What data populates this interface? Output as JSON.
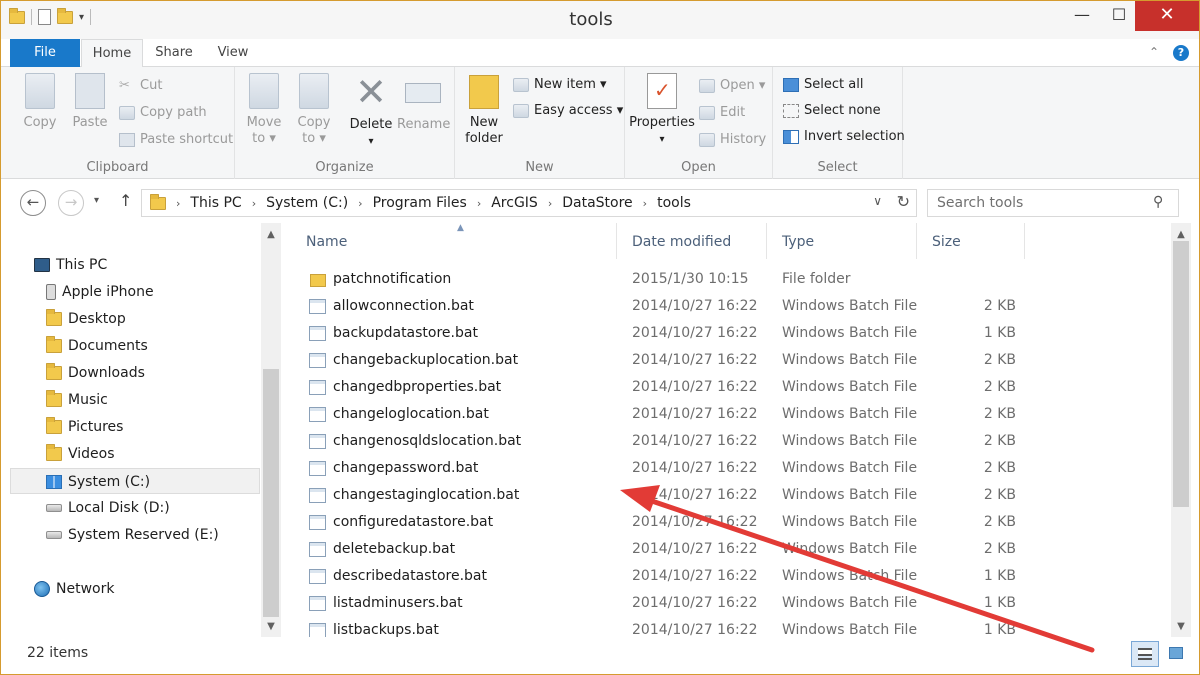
{
  "window": {
    "title": "tools",
    "minimize": "—",
    "maximize": "☐",
    "close": "✕"
  },
  "ribbon_tabs": {
    "file": "File",
    "home": "Home",
    "share": "Share",
    "view": "View"
  },
  "ribbon": {
    "clipboard": {
      "label": "Clipboard",
      "copy": "Copy",
      "paste": "Paste",
      "cut": "Cut",
      "copy_path": "Copy path",
      "paste_shortcut": "Paste shortcut"
    },
    "organize": {
      "label": "Organize",
      "move_to_1": "Move",
      "move_to_2": "to ▾",
      "copy_to_1": "Copy",
      "copy_to_2": "to ▾",
      "delete": "Delete",
      "delete_arrow": "▾",
      "rename": "Rename"
    },
    "new": {
      "label": "New",
      "new_folder_1": "New",
      "new_folder_2": "folder",
      "new_item": "New item ▾",
      "easy_access": "Easy access ▾"
    },
    "open": {
      "label": "Open",
      "properties": "Properties",
      "properties_arrow": "▾",
      "open": "Open ▾",
      "edit": "Edit",
      "history": "History"
    },
    "select": {
      "label": "Select",
      "select_all": "Select all",
      "select_none": "Select none",
      "invert_selection": "Invert selection"
    }
  },
  "address": {
    "crumbs": [
      "This PC",
      "System (C:)",
      "Program Files",
      "ArcGIS",
      "DataStore",
      "tools"
    ],
    "search_placeholder": "Search tools"
  },
  "nav_pane": {
    "this_pc": "This PC",
    "items": [
      "Apple iPhone",
      "Desktop",
      "Documents",
      "Downloads",
      "Music",
      "Pictures",
      "Videos",
      "System (C:)",
      "Local Disk (D:)",
      "System Reserved (E:)"
    ],
    "network": "Network"
  },
  "columns": {
    "name": "Name",
    "date": "Date modified",
    "type": "Type",
    "size": "Size"
  },
  "files": [
    {
      "name": "patchnotification",
      "date": "2015/1/30 10:15",
      "type": "File folder",
      "size": "",
      "icon": "folder-icon"
    },
    {
      "name": "allowconnection.bat",
      "date": "2014/10/27 16:22",
      "type": "Windows Batch File",
      "size": "2 KB",
      "icon": "batch-file-icon"
    },
    {
      "name": "backupdatastore.bat",
      "date": "2014/10/27 16:22",
      "type": "Windows Batch File",
      "size": "1 KB",
      "icon": "batch-file-icon"
    },
    {
      "name": "changebackuplocation.bat",
      "date": "2014/10/27 16:22",
      "type": "Windows Batch File",
      "size": "2 KB",
      "icon": "batch-file-icon"
    },
    {
      "name": "changedbproperties.bat",
      "date": "2014/10/27 16:22",
      "type": "Windows Batch File",
      "size": "2 KB",
      "icon": "batch-file-icon"
    },
    {
      "name": "changeloglocation.bat",
      "date": "2014/10/27 16:22",
      "type": "Windows Batch File",
      "size": "2 KB",
      "icon": "batch-file-icon"
    },
    {
      "name": "changenosqldslocation.bat",
      "date": "2014/10/27 16:22",
      "type": "Windows Batch File",
      "size": "2 KB",
      "icon": "batch-file-icon"
    },
    {
      "name": "changepassword.bat",
      "date": "2014/10/27 16:22",
      "type": "Windows Batch File",
      "size": "2 KB",
      "icon": "batch-file-icon"
    },
    {
      "name": "changestaginglocation.bat",
      "date": "2014/10/27 16:22",
      "type": "Windows Batch File",
      "size": "2 KB",
      "icon": "batch-file-icon"
    },
    {
      "name": "configuredatastore.bat",
      "date": "2014/10/27 16:22",
      "type": "Windows Batch File",
      "size": "2 KB",
      "icon": "batch-file-icon"
    },
    {
      "name": "deletebackup.bat",
      "date": "2014/10/27 16:22",
      "type": "Windows Batch File",
      "size": "2 KB",
      "icon": "batch-file-icon"
    },
    {
      "name": "describedatastore.bat",
      "date": "2014/10/27 16:22",
      "type": "Windows Batch File",
      "size": "1 KB",
      "icon": "batch-file-icon"
    },
    {
      "name": "listadminusers.bat",
      "date": "2014/10/27 16:22",
      "type": "Windows Batch File",
      "size": "1 KB",
      "icon": "batch-file-icon"
    },
    {
      "name": "listbackups.bat",
      "date": "2014/10/27 16:22",
      "type": "Windows Batch File",
      "size": "1 KB",
      "icon": "batch-file-icon"
    }
  ],
  "status": {
    "count": "22 items"
  },
  "colors": {
    "accent": "#1979ca",
    "close": "#c7302b",
    "annotation": "#e23b36"
  }
}
